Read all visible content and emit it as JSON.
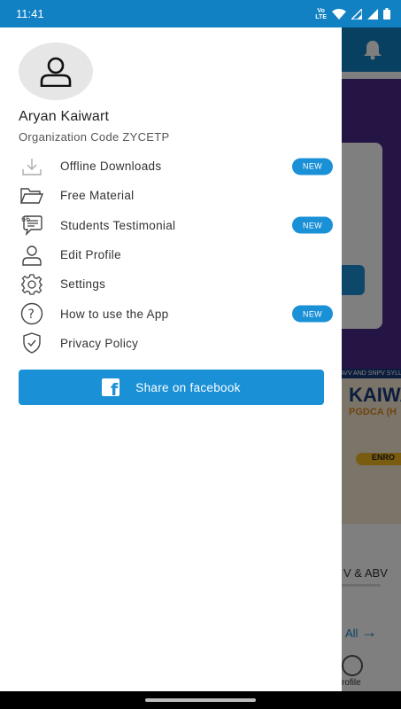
{
  "status_bar": {
    "time": "11:41",
    "network": "Vo LTE"
  },
  "background": {
    "banner_top": "AVV AND SNPV SYLL",
    "banner_title": "KAIWA",
    "banner_subtitle": "PGDCA (H",
    "banner_pill": "ENRO",
    "tab_text": "V & ABV",
    "all_link": "All",
    "nav_profile": "rofile"
  },
  "drawer": {
    "user_name": "Aryan Kaiwart",
    "org_code": "Organization Code ZYCETP",
    "menu": [
      {
        "label": "Offline Downloads",
        "icon": "download-icon",
        "badge": "NEW"
      },
      {
        "label": "Free Material",
        "icon": "folder-icon",
        "badge": ""
      },
      {
        "label": "Students Testimonial",
        "icon": "chat-bubble-icon",
        "badge": "NEW"
      },
      {
        "label": "Edit Profile",
        "icon": "user-icon",
        "badge": ""
      },
      {
        "label": "Settings",
        "icon": "gear-icon",
        "badge": ""
      },
      {
        "label": "How to use the App",
        "icon": "help-icon",
        "badge": "NEW"
      },
      {
        "label": "Privacy Policy",
        "icon": "shield-check-icon",
        "badge": ""
      }
    ],
    "share_button": {
      "label": "Share on facebook",
      "icon": "facebook-icon"
    }
  },
  "colors": {
    "status_bar": "#1181c4",
    "accent": "#1a90d6",
    "scrim": "rgba(0,0,0,0.5)"
  }
}
